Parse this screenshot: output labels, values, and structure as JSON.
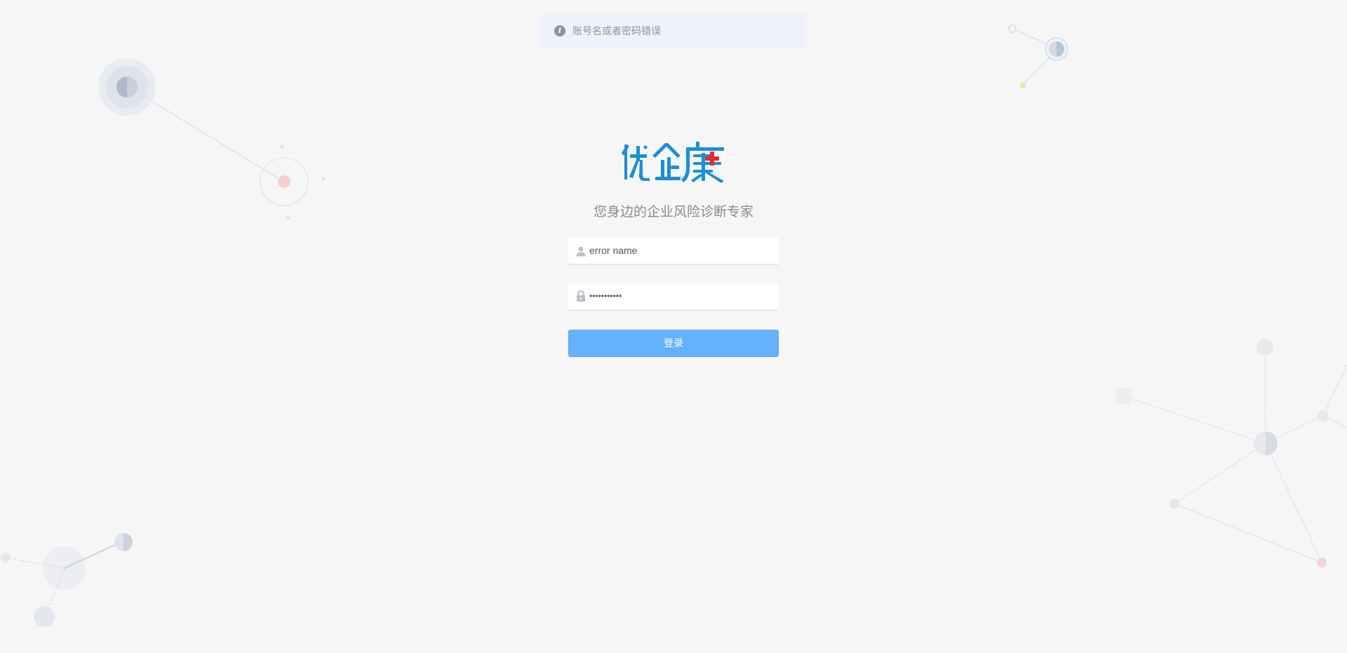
{
  "alert": {
    "message": "账号名或者密码错误",
    "icon": "info-icon"
  },
  "brand": {
    "logo_alt": "优企康",
    "slogan": "您身边的企业风险诊断专家",
    "colors": {
      "logo_blue": "#1a8fd6",
      "logo_red": "#e52b2b"
    }
  },
  "form": {
    "username_value": "error name",
    "password_value": "•••••••••••",
    "login_label": "登录",
    "user_icon": "user-icon",
    "lock_icon": "lock-icon"
  },
  "colors": {
    "background": "#f6f6f6",
    "primary_button": "#66b1ff",
    "alert_bg": "#edf2fc"
  }
}
